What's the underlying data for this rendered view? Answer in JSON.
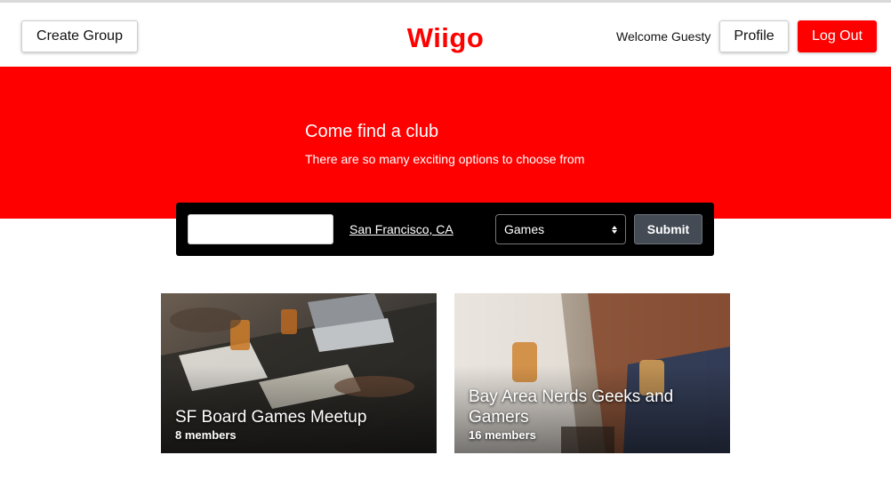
{
  "header": {
    "create_group_label": "Create Group",
    "brand": "Wiigo",
    "welcome": "Welcome Guesty",
    "profile_label": "Profile",
    "logout_label": "Log Out"
  },
  "hero": {
    "title": "Come find a club",
    "subtitle": "There are so many exciting options to choose from"
  },
  "search": {
    "query_value": "",
    "location": "San Francisco, CA",
    "category_selected": "Games",
    "submit_label": "Submit"
  },
  "groups": [
    {
      "name": "SF Board Games Meetup",
      "members": "8 members"
    },
    {
      "name": "Bay Area Nerds Geeks and Gamers",
      "members": "16 members"
    }
  ],
  "colors": {
    "brand_red": "#ff0000",
    "search_bar_bg": "#000000",
    "submit_bg": "#444b54"
  }
}
